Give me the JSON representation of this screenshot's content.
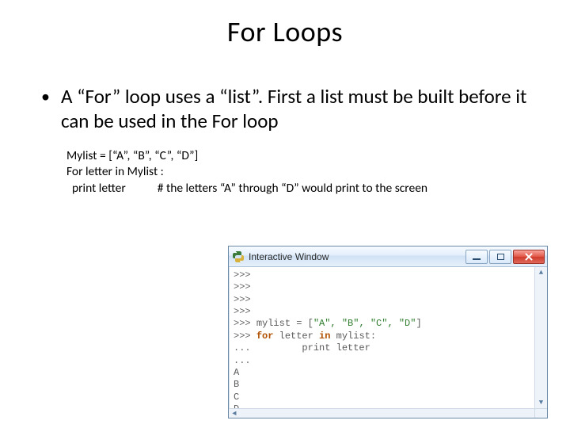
{
  "title": "For Loops",
  "bullet": "A “For” loop uses a “list”. First a list must be built before it can be used in the For loop",
  "code": {
    "l1": "Mylist = [“A”, “B”, “C”, “D”]",
    "l2": "For letter in Mylist :",
    "l3": "  print letter",
    "l3_comment": "# the letters “A” through “D” would print to the screen"
  },
  "window": {
    "title": "Interactive Window"
  },
  "console": {
    "p": ">>> ",
    "cont": "... ",
    "assign_pre": "mylist = [",
    "assign_body": "\"A\", \"B\", \"C\", \"D\"",
    "assign_post": "]",
    "for_kw": "for",
    "for_mid": " letter ",
    "in_kw": "in",
    "for_tail": " mylist:",
    "print_line": "        print letter",
    "outA": "A",
    "outB": "B",
    "outC": "C",
    "outD": "D"
  }
}
